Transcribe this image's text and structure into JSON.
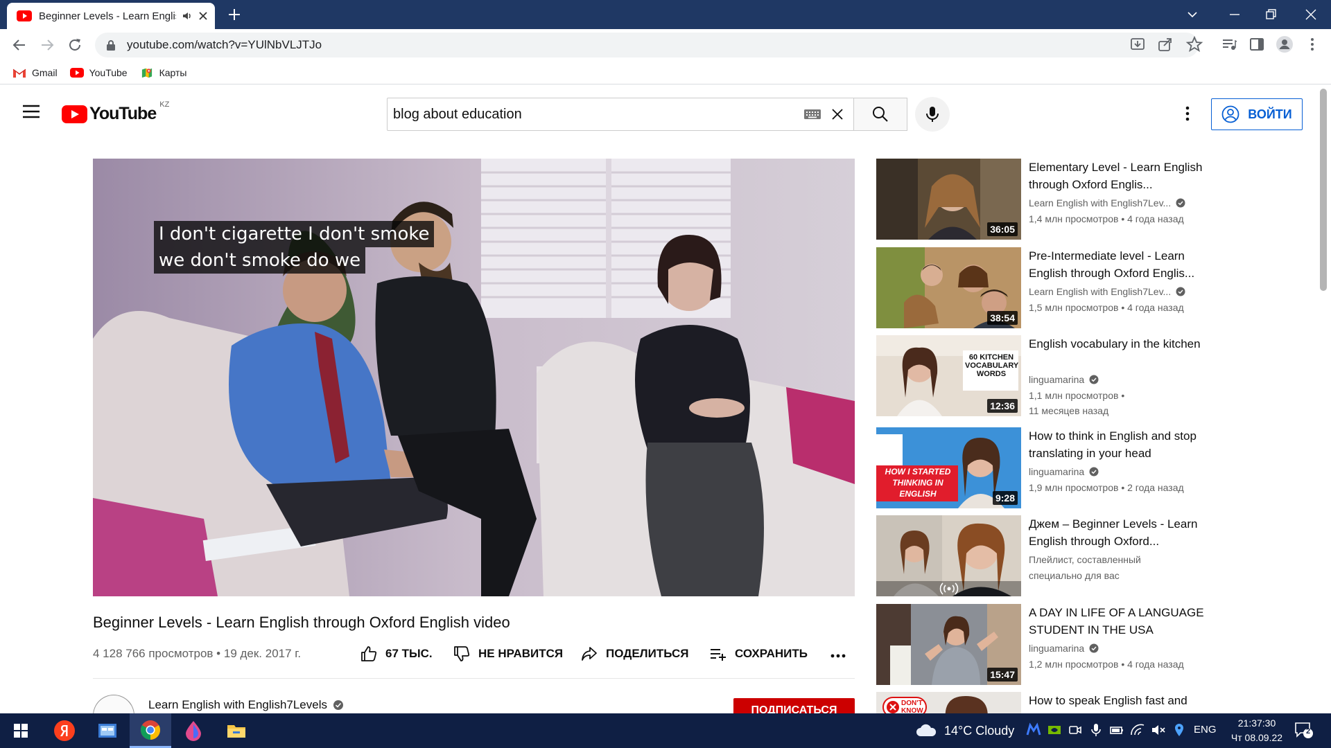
{
  "browser": {
    "tab_title": "Beginner Levels - Learn English through Oxford English video",
    "url": "youtube.com/watch?v=YUlNbVLJTJo",
    "bookmarks": [
      {
        "label": "Gmail",
        "icon": "gmail-icon"
      },
      {
        "label": "YouTube",
        "icon": "youtube-icon"
      },
      {
        "label": "Карты",
        "icon": "maps-icon"
      }
    ]
  },
  "header": {
    "logo_text": "YouTube",
    "country": "KZ",
    "search_value": "blog about education",
    "signin_label": "ВОЙТИ"
  },
  "video": {
    "caption_line1": "I don't cigarette I don't smoke",
    "caption_line2": "we don't smoke do we",
    "title": "Beginner Levels - Learn English through Oxford English video",
    "views_date": "4 128 766 просмотров • 19 дек. 2017 г.",
    "like_label": "67 ТЫС.",
    "dislike_label": "НЕ НРАВИТСЯ",
    "share_label": "ПОДЕЛИТЬСЯ",
    "save_label": "СОХРАНИТЬ",
    "channel_name": "Learn English with English7Levels",
    "subscribe_label": "ПОДПИСАТЬСЯ"
  },
  "related": [
    {
      "title": "Elementary Level - Learn English through Oxford Englis...",
      "channel": "Learn English with English7Lev...",
      "verified": true,
      "meta1": "1,4 млн просмотров • 4 года назад",
      "meta2": "",
      "duration": "36:05"
    },
    {
      "title": "Pre-Intermediate level - Learn English through Oxford Englis...",
      "channel": "Learn English with English7Lev...",
      "verified": true,
      "meta1": "1,5 млн просмотров • 4 года назад",
      "meta2": "",
      "duration": "38:54"
    },
    {
      "title": "English vocabulary in the kitchen",
      "channel": "linguamarina",
      "verified": true,
      "meta1": "1,1 млн просмотров •",
      "meta2": "11 месяцев назад",
      "duration": "12:36",
      "thumb_text": "60 KITCHEN VOCABULARY WORDS"
    },
    {
      "title": "How to think in English and stop translating in your head",
      "channel": "linguamarina",
      "verified": true,
      "meta1": "1,9 млн просмотров • 2 года назад",
      "meta2": "",
      "duration": "9:28",
      "thumb_text": "HOW I STARTED THINKING IN ENGLISH"
    },
    {
      "title": "Джем – Beginner Levels - Learn English through Oxford...",
      "channel": "Плейлист, составленный",
      "verified": false,
      "meta1": "специально для вас",
      "meta2": "",
      "duration": ""
    },
    {
      "title": "A DAY IN LIFE OF A LANGUAGE STUDENT IN THE USA",
      "channel": "linguamarina",
      "verified": true,
      "meta1": "1,2 млн просмотров • 4 года назад",
      "meta2": "",
      "duration": "15:47"
    },
    {
      "title": "How to speak English fast and",
      "channel": "",
      "verified": false,
      "meta1": "",
      "meta2": "",
      "duration": "",
      "thumb_text": "DON'T KNOW"
    }
  ],
  "taskbar": {
    "weather": "14°C  Cloudy",
    "lang": "ENG",
    "time": "21:37:30",
    "date": "Чт 08.09.22",
    "notifications": "2"
  },
  "colors": {
    "tabstrip": "#1f3864",
    "yt_red": "#ff0000",
    "link_blue": "#065fd4",
    "taskbar": "#0f1f44"
  }
}
